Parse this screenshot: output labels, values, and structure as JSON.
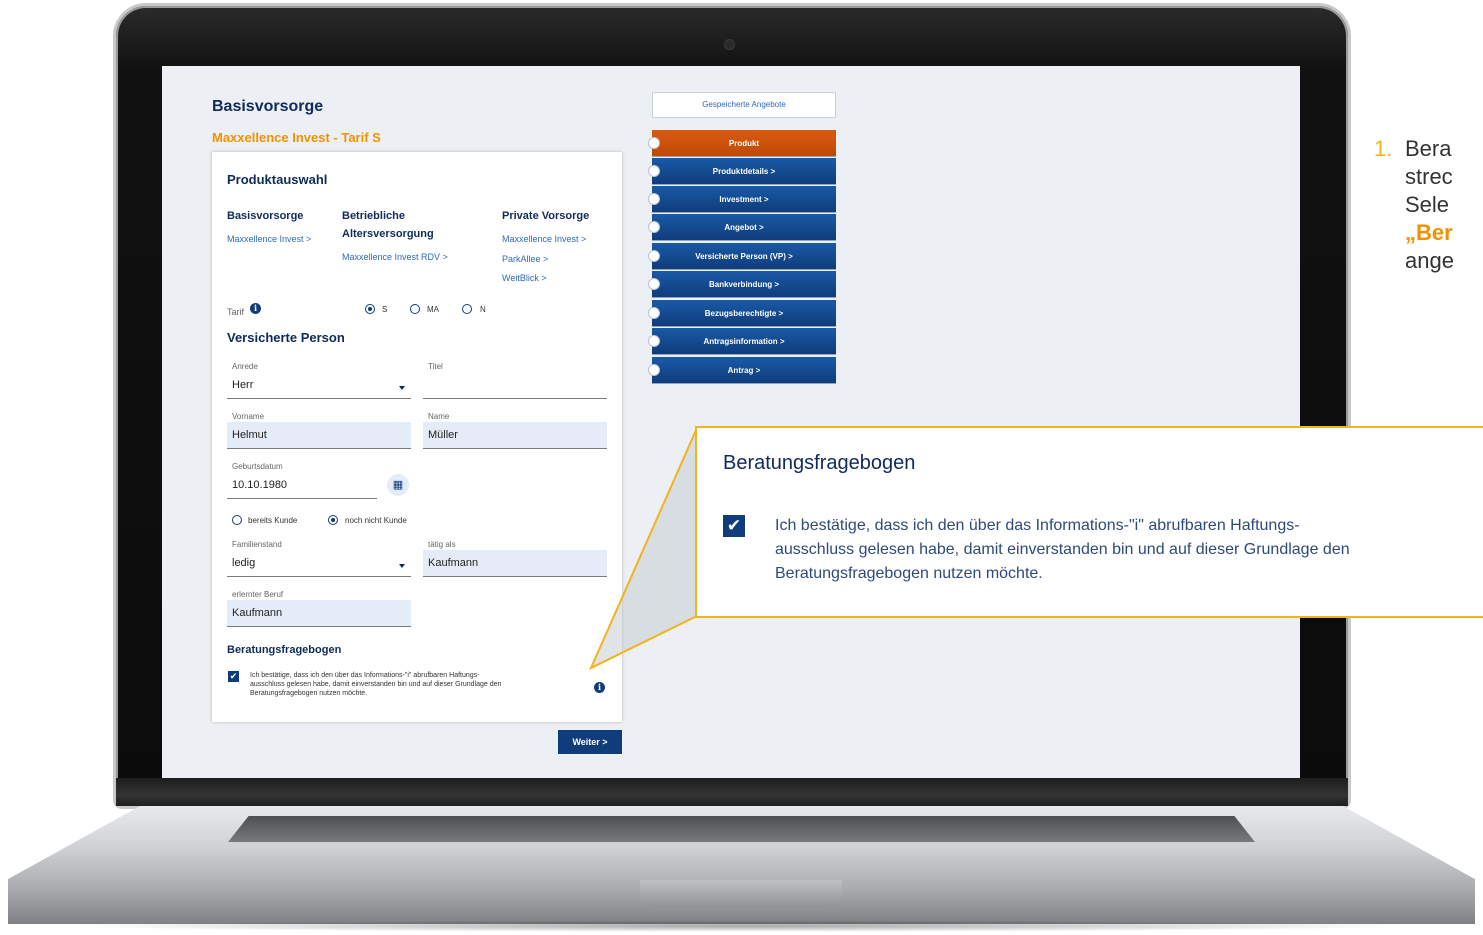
{
  "app": {
    "title": "Basisvorsorge",
    "subtitle": "Maxxellence Invest - Tarif S"
  },
  "produktauswahl": {
    "heading": "Produktauswahl",
    "columns": [
      {
        "title": "Basisvorsorge",
        "links": [
          "Maxxellence Invest >"
        ]
      },
      {
        "title_line1": "Betriebliche",
        "title_line2": "Altersversorgung",
        "links": [
          "Maxxellence Invest RDV >"
        ]
      },
      {
        "title": "Private Vorsorge",
        "links": [
          "Maxxellence Invest >",
          "ParkAllee >",
          "WeitBlick >"
        ]
      }
    ]
  },
  "tarif": {
    "label": "Tarif",
    "options": [
      "S",
      "MA",
      "N"
    ],
    "selected": "S"
  },
  "versicherte_person": {
    "heading": "Versicherte Person",
    "anrede": {
      "label": "Anrede",
      "value": "Herr"
    },
    "titel": {
      "label": "Titel",
      "value": ""
    },
    "vorname": {
      "label": "Vorname",
      "value": "Helmut"
    },
    "name": {
      "label": "Name",
      "value": "Müller"
    },
    "geburtsdatum": {
      "label": "Geburtsdatum",
      "value": "10.10.1980"
    },
    "kunde_options": [
      "bereits Kunde",
      "noch nicht Kunde"
    ],
    "kunde_selected": "noch nicht Kunde",
    "familienstand": {
      "label": "Familienstand",
      "value": "ledig"
    },
    "taetig_als": {
      "label": "tätig als",
      "value": "Kaufmann"
    },
    "erlernter_beruf": {
      "label": "erlernter Beruf",
      "value": "Kaufmann"
    }
  },
  "beratungsfragebogen": {
    "heading": "Beratungsfragebogen",
    "checked": true,
    "text_line1": "Ich bestätige, dass ich den über das Informations-\"i\" abrufbaren Haftungs-",
    "text_line2": "ausschluss gelesen habe, damit einverstanden bin und auf dieser Grundlage den",
    "text_line3": "Beratungsfragebogen nutzen möchte."
  },
  "weiter_label": "Weiter >",
  "nav": {
    "saved_offers": "Gespeicherte Angebote",
    "items": [
      {
        "label": "Produkt",
        "active": true
      },
      {
        "label": "Produktdetails >"
      },
      {
        "label": "Investment >"
      },
      {
        "label": "Angebot >"
      },
      {
        "label": "Versicherte Person (VP) >"
      },
      {
        "label": "Bankverbindung >"
      },
      {
        "label": "Bezugsberechtigte >"
      },
      {
        "label": "Antragsinformation >"
      },
      {
        "label": "Antrag >"
      }
    ]
  },
  "callout": {
    "title": "Beratungsfragebogen",
    "line1": "Ich bestätige, dass ich den über das Informations-\"i\" abrufbaren Haftungs-",
    "line2": "ausschluss gelesen habe, damit einverstanden bin und auf dieser Grundlage den",
    "line3": "Beratungsfragebogen nutzen möchte."
  },
  "annotation": {
    "number": "1.",
    "lines": [
      "Bera",
      "strec",
      "Sele",
      "„Ber",
      "ange"
    ]
  },
  "colors": {
    "navy": "#0f2b5b",
    "accent_orange": "#f39200",
    "nav_blue": "#0f3c7a",
    "active_orange": "#bf4a05",
    "callout_border": "#f3b31b"
  }
}
